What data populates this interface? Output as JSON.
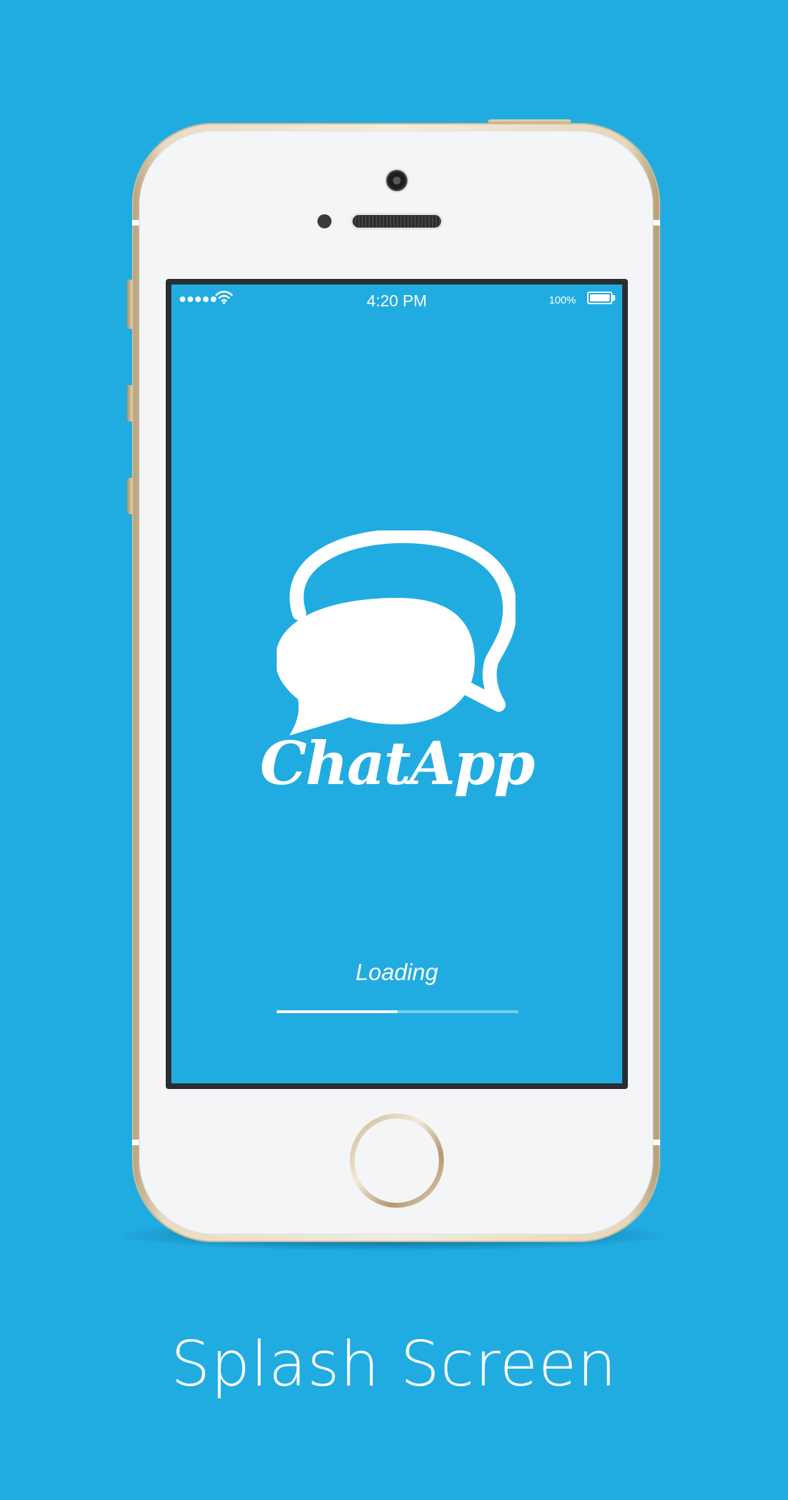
{
  "status_bar": {
    "time": "4:20 PM",
    "battery_percent": "100%",
    "signal_dots": 5,
    "icons": [
      "signal-dots-icon",
      "wifi-icon",
      "battery-icon"
    ]
  },
  "splash": {
    "app_name": "ChatApp",
    "logo_icon": "chat-bubbles-icon",
    "loading_label": "Loading",
    "loading_progress": 0.5
  },
  "caption": "Splash Screen",
  "colors": {
    "background": "#21ace1",
    "screen": "#21ace1",
    "foreground": "#ffffff",
    "phone_face": "#f4f5f7",
    "phone_frame": "#e9dcc3"
  }
}
